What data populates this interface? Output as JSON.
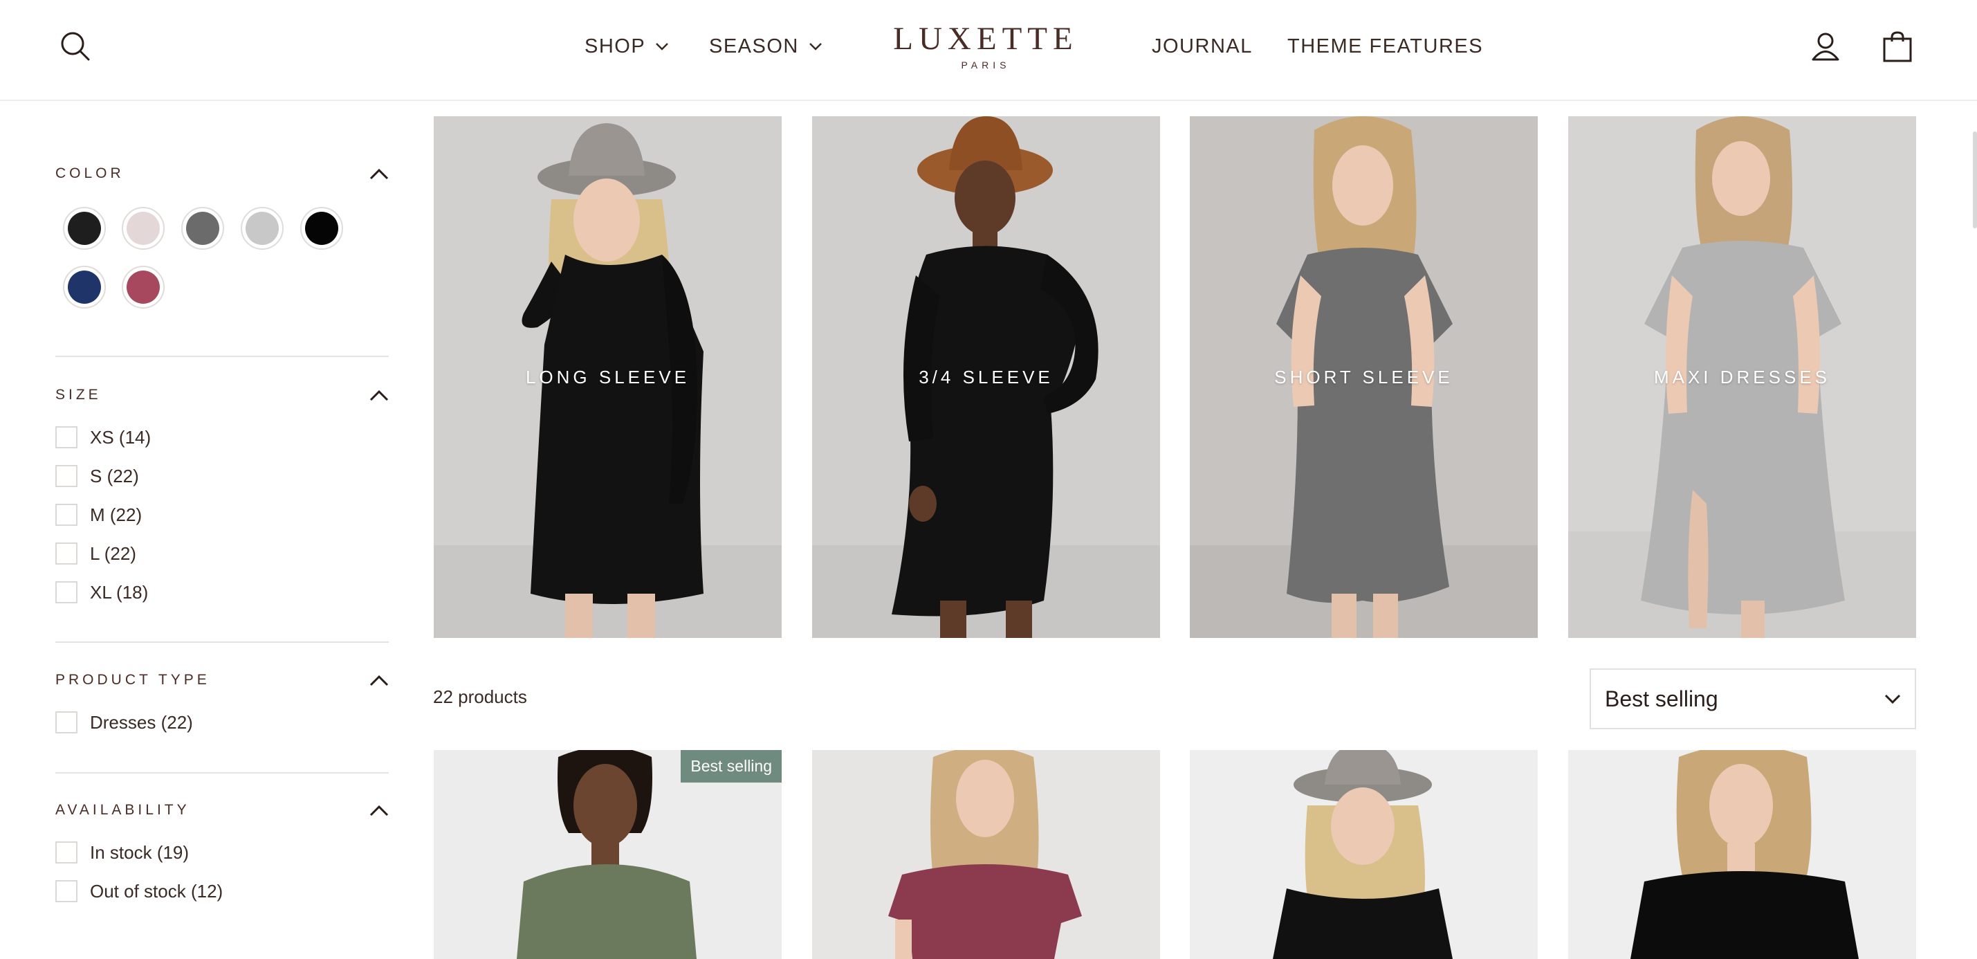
{
  "header": {
    "nav": {
      "shop": "SHOP",
      "season": "SEASON",
      "journal": "JOURNAL",
      "theme_features": "THEME FEATURES"
    },
    "logo": {
      "main": "LUXETTE",
      "sub": "PARIS"
    },
    "icons": {
      "search": "search-icon",
      "account": "user-icon",
      "cart": "shopping-bag-icon"
    }
  },
  "filters": {
    "color": {
      "title": "COLOR",
      "swatches": [
        "#1e1e1e",
        "#e4d7d8",
        "#6b6b6b",
        "#c8c8c8",
        "#050505",
        "#1f3468",
        "#a8485e"
      ]
    },
    "size": {
      "title": "SIZE",
      "options": [
        "XS (14)",
        "S (22)",
        "M (22)",
        "L (22)",
        "XL (18)"
      ]
    },
    "product_type": {
      "title": "PRODUCT TYPE",
      "options": [
        "Dresses (22)"
      ]
    },
    "availability": {
      "title": "AVAILABILITY",
      "options": [
        "In stock (19)",
        "Out of stock (12)"
      ]
    }
  },
  "collections": [
    {
      "label": "LONG SLEEVE"
    },
    {
      "label": "3/4 SLEEVE"
    },
    {
      "label": "SHORT SLEEVE"
    },
    {
      "label": "MAXI DRESSES"
    }
  ],
  "toolbar": {
    "product_count": "22 products",
    "sort": "Best selling"
  },
  "products": [
    {
      "badge": "Best selling",
      "color": "#6b7a5c"
    },
    {
      "color": "#8c3a4e"
    },
    {
      "color": "#111111"
    },
    {
      "color": "#0c0c0c"
    }
  ]
}
